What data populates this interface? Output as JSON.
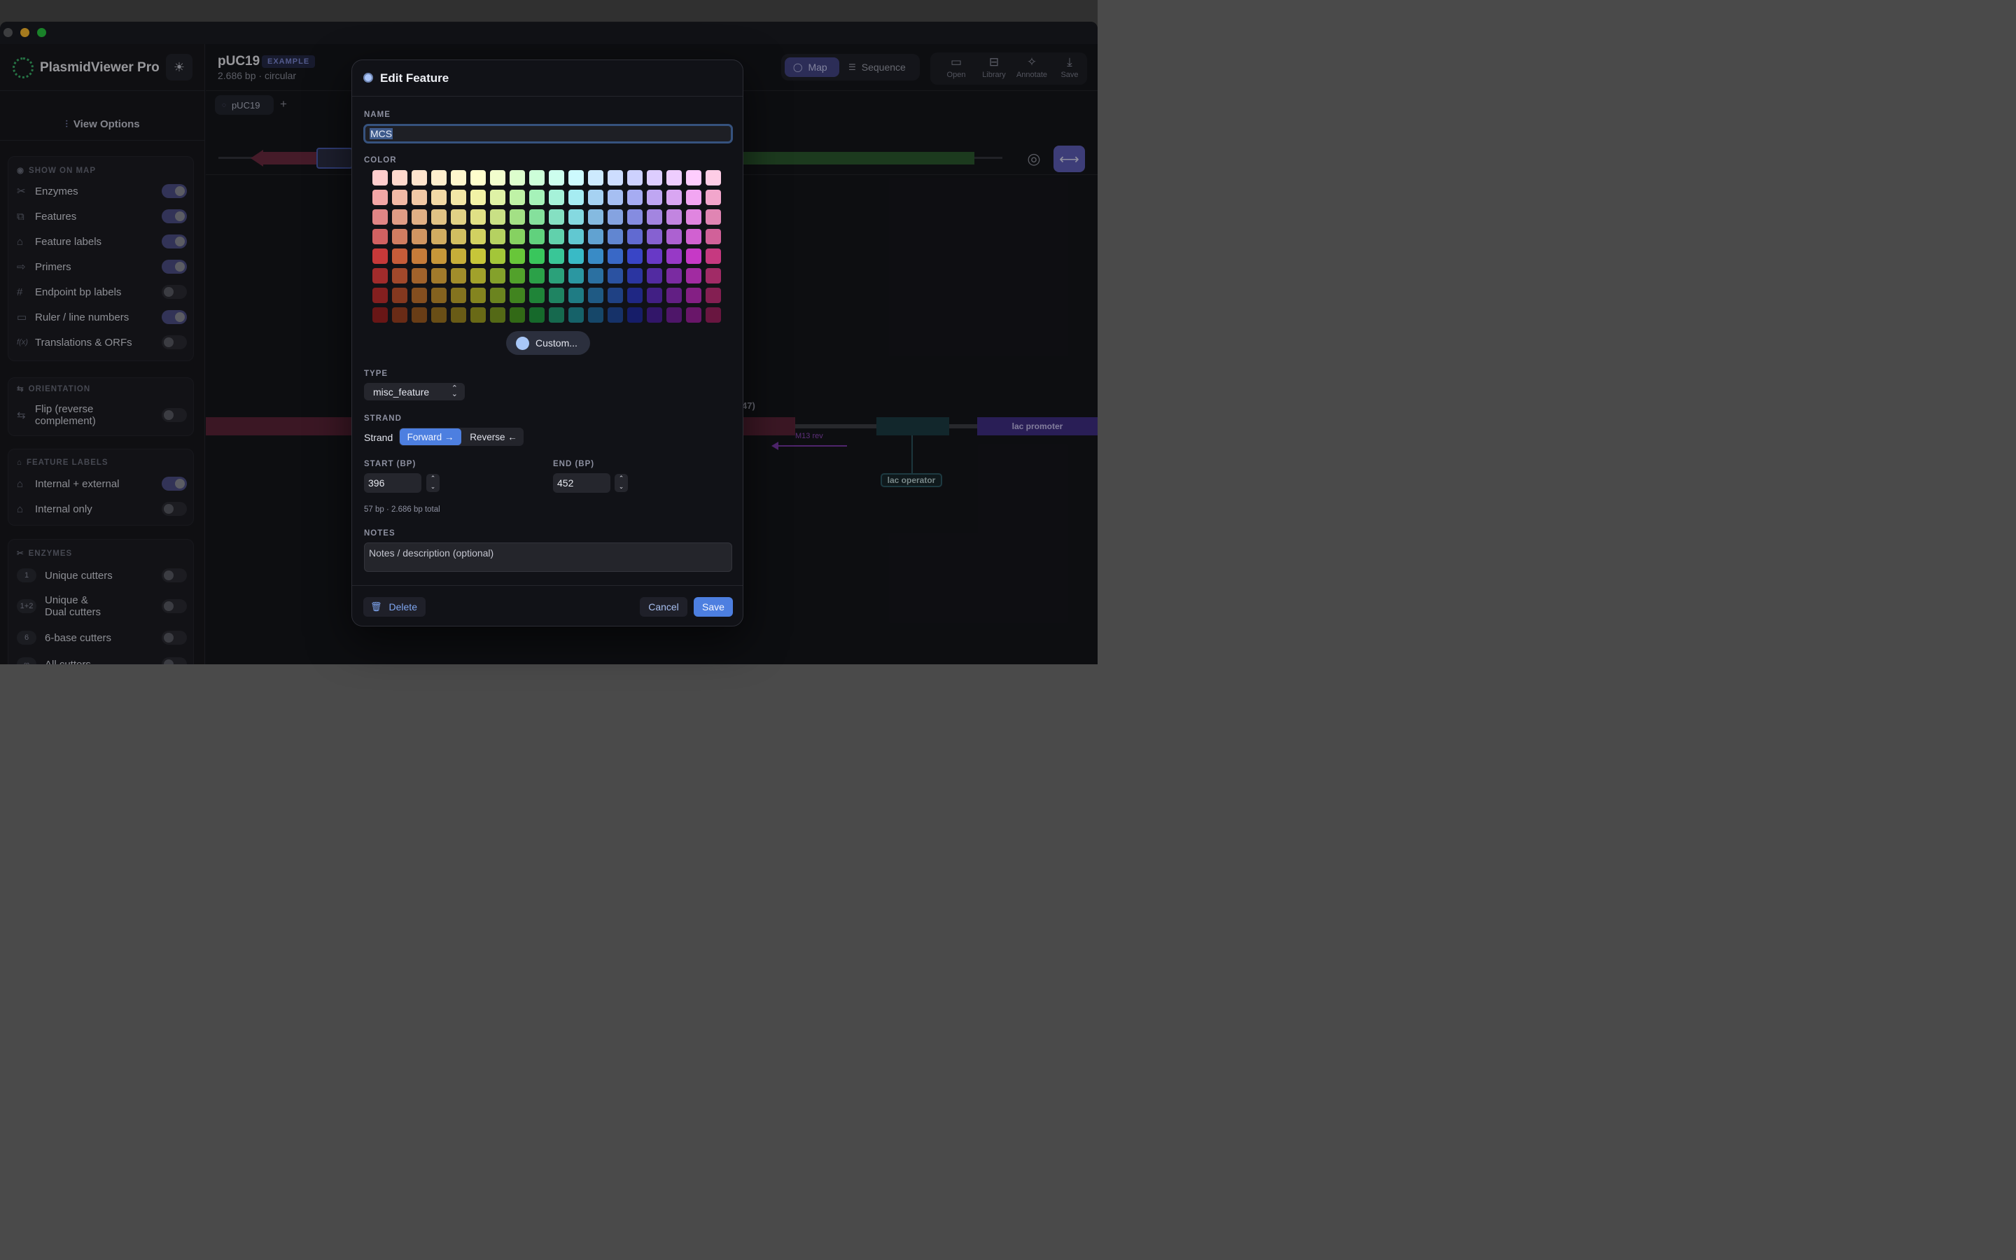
{
  "app": {
    "name": "PlasmidViewer Pro",
    "theme_icon": "sun-icon"
  },
  "sidebar": {
    "view_options_label": "View Options",
    "show_on_map": {
      "header": "SHOW ON MAP",
      "items": [
        {
          "label": "Enzymes",
          "icon": "scissors-icon",
          "on": true
        },
        {
          "label": "Features",
          "icon": "layers-icon",
          "on": true
        },
        {
          "label": "Feature labels",
          "icon": "tag-icon",
          "on": true
        },
        {
          "label": "Primers",
          "icon": "arrow-right-icon",
          "on": true
        },
        {
          "label": "Endpoint bp labels",
          "icon": "hash-icon",
          "on": false
        },
        {
          "label": "Ruler / line numbers",
          "icon": "ruler-icon",
          "on": true
        },
        {
          "label": "Translations & ORFs",
          "icon": "function-icon",
          "icon_text": "f(x)",
          "on": false
        }
      ]
    },
    "orientation": {
      "header": "ORIENTATION",
      "items": [
        {
          "label": "Flip (reverse complement)",
          "label_line1": "Flip (reverse",
          "label_line2": "complement)",
          "on": false
        }
      ]
    },
    "feature_labels": {
      "header": "FEATURE LABELS",
      "items": [
        {
          "label": "Internal + external",
          "on": true
        },
        {
          "label": "Internal only",
          "on": false
        }
      ]
    },
    "enzymes": {
      "header": "ENZYMES",
      "items": [
        {
          "badge": "1",
          "label": "Unique cutters",
          "on": false
        },
        {
          "badge": "1+2",
          "label_line1": "Unique &",
          "label_line2": "Dual cutters",
          "on": false
        },
        {
          "badge": "6",
          "label": "6-base cutters",
          "on": false
        },
        {
          "badge": "∞",
          "label": "All cutters",
          "on": false
        }
      ]
    }
  },
  "header": {
    "title": "pUC19",
    "badge": "EXAMPLE",
    "subtitle": "2.686 bp · circular",
    "view_toggle": {
      "map": "Map",
      "sequence": "Sequence",
      "active": "map"
    },
    "tools": [
      {
        "label": "Open",
        "icon": "folder-icon"
      },
      {
        "label": "Library",
        "icon": "inbox-icon"
      },
      {
        "label": "Annotate",
        "icon": "wand-icon"
      },
      {
        "label": "Save",
        "icon": "download-icon"
      }
    ]
  },
  "tabs": {
    "items": [
      {
        "label": "pUC19"
      }
    ],
    "add": "+"
  },
  "map": {
    "partial_label": "47)",
    "features": {
      "lac_promoter": "lac promoter",
      "lac_operator": "lac operator",
      "m13_rev": "M13 rev"
    }
  },
  "dialog": {
    "title": "Edit Feature",
    "name_label": "NAME",
    "name_value": "MCS",
    "color_label": "COLOR",
    "selected_color": "#a8c7f7",
    "custom_label": "Custom...",
    "type_label": "TYPE",
    "type_value": "misc_feature",
    "strand_label": "STRAND",
    "strand_text": "Strand",
    "strand_forward": "Forward →",
    "strand_reverse": "Reverse ←",
    "strand_active": "forward",
    "start_label": "START (BP)",
    "start_value": "396",
    "end_label": "END (BP)",
    "end_value": "452",
    "length_info": "57 bp · 2.686 bp total",
    "notes_label": "NOTES",
    "notes_placeholder": "Notes / description (optional)",
    "delete_label": "Delete",
    "cancel_label": "Cancel",
    "save_label": "Save"
  },
  "palette": {
    "columns": 18,
    "rows": 8,
    "hues": [
      0,
      15,
      28,
      40,
      50,
      60,
      75,
      100,
      135,
      160,
      185,
      205,
      220,
      235,
      260,
      280,
      300,
      330
    ],
    "lightness": [
      90,
      80,
      70,
      60,
      50,
      40,
      32,
      25
    ],
    "saturation": [
      95,
      75,
      60,
      55,
      55,
      58,
      62,
      65
    ]
  }
}
